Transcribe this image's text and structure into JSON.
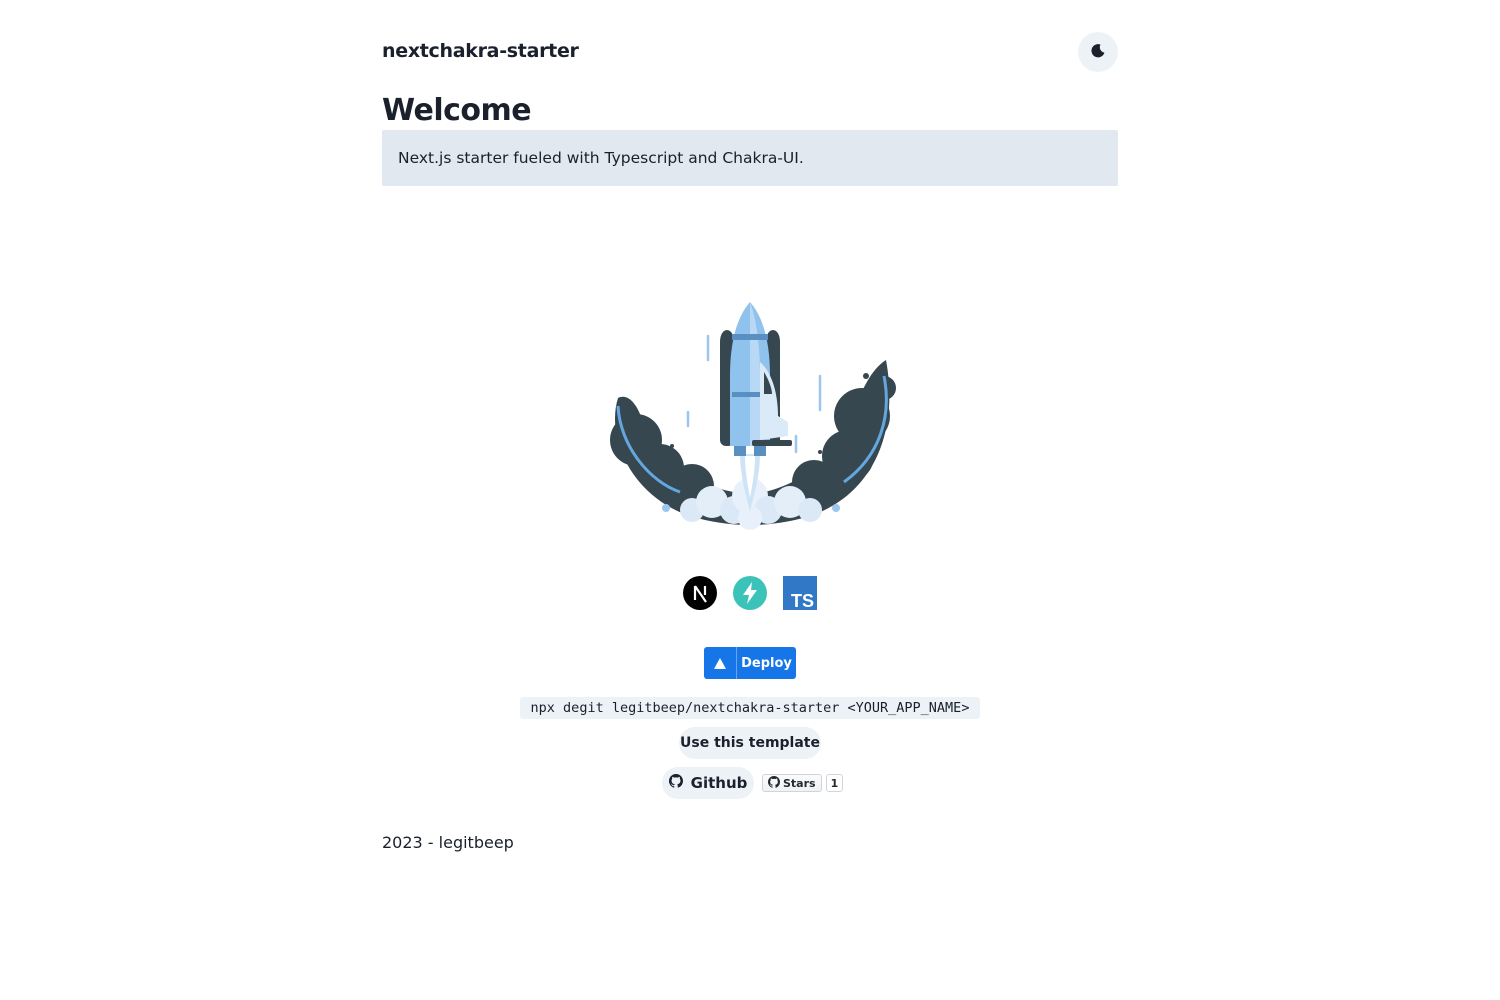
{
  "header": {
    "title": "nextchakra-starter",
    "theme_toggle_icon": "moon-icon"
  },
  "main": {
    "heading": "Welcome",
    "tagline": "Next.js starter fueled with Typescript and Chakra-UI.",
    "hero_image": "rocket-launch-illustration",
    "tech_icons": [
      "nextjs-logo-icon",
      "chakra-ui-logo-icon",
      "typescript-logo-icon"
    ],
    "ts_logo_text": "TS",
    "deploy_label": "Deploy",
    "command": "npx degit legitbeep/nextchakra-starter <YOUR_APP_NAME>",
    "template_button": "Use this template",
    "github_button": "Github",
    "stars_label": "Stars",
    "stars_count": "1"
  },
  "footer": {
    "text": "2023 - legitbeep"
  },
  "colors": {
    "accent_blue": "#1676e8",
    "tagline_bg": "#e2e8f0",
    "button_bg": "#edf2f7",
    "text": "#1a202c",
    "chakra_teal": "#3cc3b9",
    "typescript_blue": "#3178c6"
  }
}
